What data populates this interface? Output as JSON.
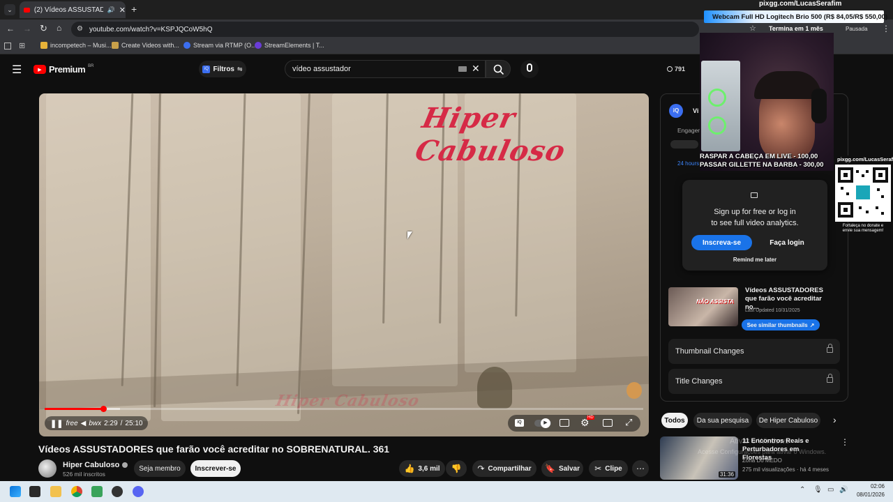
{
  "browser": {
    "tab_title": "(2) Vídeos ASSUSTADORES",
    "url": "youtube.com/watch?v=KSPJQCoW5hQ",
    "bookmarks": [
      "incompetech – Musi...",
      "Create Videos with...",
      "Stream via RTMP (O...",
      "StreamElements | T..."
    ],
    "status_text": "Termina em 1 mês",
    "profile_status": "Pausada"
  },
  "youtube": {
    "logo_text": "Premium",
    "logo_region": "BR",
    "filters_label": "Filtros",
    "search_value": "vídeo assustador",
    "views_badge": "791"
  },
  "video": {
    "overlay_brand": "Hiper Cabuloso",
    "watermark": "Hiper Cabuloso",
    "time_current": "2:29",
    "time_separator": "/",
    "time_total": "25:10",
    "free_label": "free",
    "bwx_label": "bwx",
    "progress_fraction": 0.119,
    "hd_badge": "HD",
    "title": "Vídeos ASSUSTADORES que farão você acreditar no SOBRENATURAL. 361",
    "channel_name": "Hiper Cabuloso",
    "subscribers": "526 mil inscritos",
    "member_label": "Seja membro",
    "subscribe_label": "Inscrever-se",
    "likes": "3,6 mil",
    "share_label": "Compartilhar",
    "save_label": "Salvar",
    "clip_label": "Clipe"
  },
  "side_panel": {
    "tab_partial": "Vi",
    "engagement_label": "Engager",
    "hours_label": "24 hours",
    "popup_text_line1": "Sign up for free or log in",
    "popup_text_line2": "to see full video analytics.",
    "signup_label": "Inscreva-se",
    "login_label": "Faça login",
    "remind_label": "Remind me later",
    "thumb_card_title": "Vídeos ASSUSTADORES que farão você acreditar no...",
    "thumb_card_overlay": "NÃO ASSISTA",
    "last_updated": "Last Updated 10/31/2025",
    "similar_label": "See similar thumbnails",
    "thumbnail_changes": "Thumbnail Changes",
    "title_changes": "Title Changes"
  },
  "recommendations": {
    "chips": [
      "Todos",
      "Da sua pesquisa",
      "De Hiper Cabuloso"
    ],
    "item": {
      "title": "11 Encontros Reais e Perturbadores em Florestas",
      "channel": "Zona Do MEDO",
      "meta": "275 mil visualizações · há 4 meses",
      "duration": "31:36"
    }
  },
  "stream_overlay": {
    "site": "pixgg.com/LucasSerafim",
    "banner": "Webcam Full HD Logitech Brio 500 (R$ 84,05/R$ 550,00)",
    "cam_line1": "RASPAR A CABEÇA EM LIVE - 100,00",
    "cam_line2": "PASSAR GILLETTE NA BARBA - 300,00",
    "qr_site": "pixgg.com/LucasSerafim",
    "qr_caption": "Fortaleça no donate e envie sua mensagem!"
  },
  "watermark": {
    "line1": "Ativar o Windows",
    "line2": "Acesse Configurações para ativar o Windows."
  },
  "taskbar": {
    "time": "02:06",
    "date": "08/01/2026"
  },
  "colors": {
    "youtube_red": "#ff0000",
    "accent_blue": "#1a73e8",
    "brand_red": "#d62a46"
  }
}
